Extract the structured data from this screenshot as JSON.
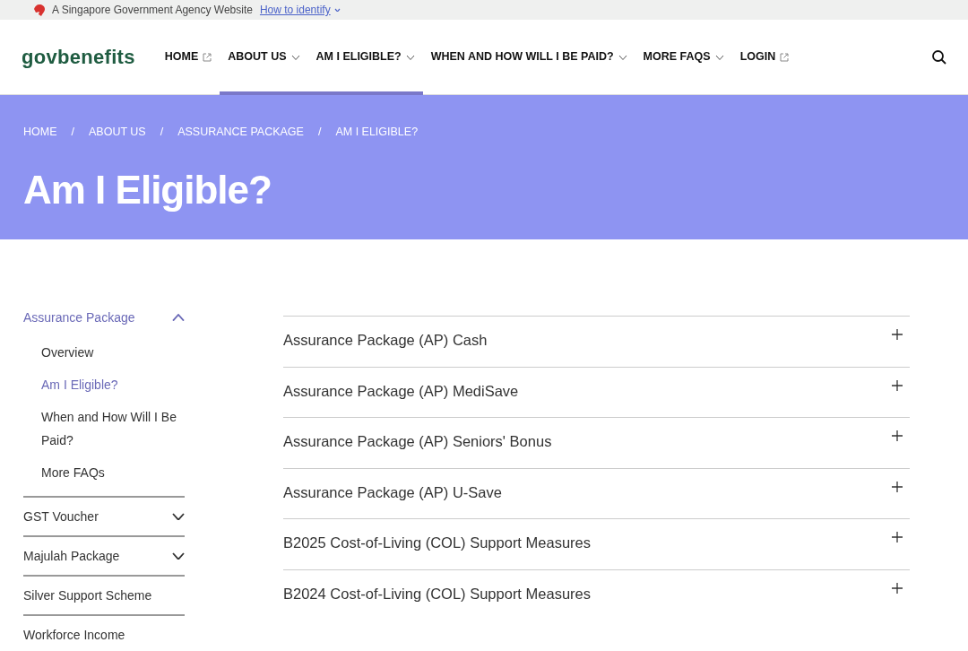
{
  "masthead": {
    "text": "A Singapore Government Agency Website",
    "link": "How to identify"
  },
  "header": {
    "logo": "govbenefits",
    "nav": [
      {
        "label": "HOME",
        "kind": "external",
        "highlighted": false
      },
      {
        "label": "ABOUT US",
        "kind": "dropdown",
        "highlighted": true
      },
      {
        "label": "AM I ELIGIBLE?",
        "kind": "dropdown",
        "highlighted": true
      },
      {
        "label": "WHEN AND HOW WILL I BE PAID?",
        "kind": "dropdown",
        "highlighted": false
      },
      {
        "label": "MORE FAQS",
        "kind": "dropdown",
        "highlighted": false
      },
      {
        "label": "LOGIN",
        "kind": "external",
        "highlighted": false
      }
    ]
  },
  "hero": {
    "breadcrumbs": [
      "HOME",
      "ABOUT US",
      "ASSURANCE PACKAGE",
      "AM I ELIGIBLE?"
    ],
    "separator": "/",
    "title": "Am I Eligible?"
  },
  "sidebar": {
    "items": [
      {
        "label": "Assurance Package",
        "expandable": true,
        "expanded": true,
        "children": [
          {
            "label": "Overview",
            "selected": false
          },
          {
            "label": "Am I Eligible?",
            "selected": true
          },
          {
            "label": "When and How Will I Be Paid?",
            "selected": false
          },
          {
            "label": "More FAQs",
            "selected": false
          }
        ]
      },
      {
        "label": "GST Voucher",
        "expandable": true,
        "expanded": false
      },
      {
        "label": "Majulah Package",
        "expandable": true,
        "expanded": false
      },
      {
        "label": "Silver Support Scheme",
        "expandable": false,
        "expanded": false
      },
      {
        "label": "Workforce Income",
        "expandable": false,
        "expanded": false
      }
    ]
  },
  "accordion": [
    {
      "title": "Assurance Package (AP) Cash",
      "expanded": false
    },
    {
      "title": "Assurance Package (AP) MediSave",
      "expanded": false
    },
    {
      "title": "Assurance Package (AP) Seniors' Bonus",
      "expanded": false
    },
    {
      "title": "Assurance Package (AP) U-Save",
      "expanded": false
    },
    {
      "title": "B2025 Cost-of-Living (COL) Support Measures",
      "expanded": false
    },
    {
      "title": "B2024 Cost-of-Living (COL) Support Measures",
      "expanded": false
    }
  ]
}
